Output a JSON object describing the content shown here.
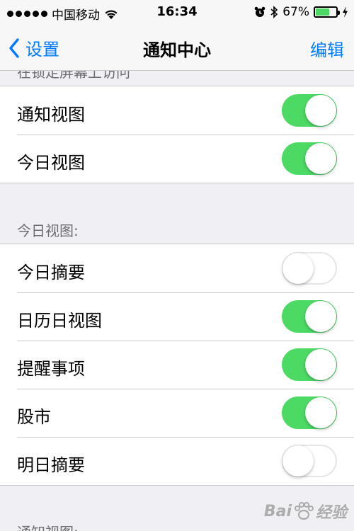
{
  "status_bar": {
    "carrier": "中国移动",
    "time": "16:34",
    "battery_percent_label": "67%",
    "battery_level": 0.67
  },
  "nav_bar": {
    "back_label": "设置",
    "title": "通知中心",
    "edit_label": "编辑"
  },
  "sections": [
    {
      "header": "在锁定屏幕上访问",
      "rows": [
        {
          "label": "通知视图",
          "on": true
        },
        {
          "label": "今日视图",
          "on": true
        }
      ]
    },
    {
      "header": "今日视图:",
      "rows": [
        {
          "label": "今日摘要",
          "on": false
        },
        {
          "label": "日历日视图",
          "on": true
        },
        {
          "label": "提醒事项",
          "on": true
        },
        {
          "label": "股市",
          "on": true
        },
        {
          "label": "明日摘要",
          "on": false
        }
      ]
    },
    {
      "header": "通知视图:",
      "rows": []
    }
  ],
  "watermark": {
    "text_left": "Bai",
    "text_right": "经验"
  },
  "colors": {
    "accent": "#007aff",
    "toggle_on": "#4cd964",
    "background": "#efeff4"
  }
}
